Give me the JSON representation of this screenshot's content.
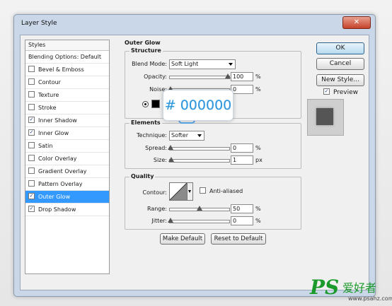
{
  "window": {
    "title": "Layer Style",
    "close_icon": "close-icon"
  },
  "styles_panel": {
    "header": "Styles",
    "blending": "Blending Options: Default",
    "items": [
      {
        "label": "Bevel & Emboss",
        "checked": false,
        "indent": false,
        "selected": false
      },
      {
        "label": "Contour",
        "checked": false,
        "indent": true,
        "selected": false
      },
      {
        "label": "Texture",
        "checked": false,
        "indent": true,
        "selected": false
      },
      {
        "label": "Stroke",
        "checked": false,
        "indent": false,
        "selected": false
      },
      {
        "label": "Inner Shadow",
        "checked": true,
        "indent": false,
        "selected": false
      },
      {
        "label": "Inner Glow",
        "checked": true,
        "indent": false,
        "selected": false
      },
      {
        "label": "Satin",
        "checked": false,
        "indent": false,
        "selected": false
      },
      {
        "label": "Color Overlay",
        "checked": false,
        "indent": false,
        "selected": false
      },
      {
        "label": "Gradient Overlay",
        "checked": false,
        "indent": false,
        "selected": false
      },
      {
        "label": "Pattern Overlay",
        "checked": false,
        "indent": false,
        "selected": false
      },
      {
        "label": "Outer Glow",
        "checked": true,
        "indent": false,
        "selected": true
      },
      {
        "label": "Drop Shadow",
        "checked": true,
        "indent": false,
        "selected": false
      }
    ]
  },
  "outer_glow": {
    "title": "Outer Glow",
    "structure": {
      "title": "Structure",
      "blend_mode_label": "Blend Mode:",
      "blend_mode": "Soft Light",
      "opacity_label": "Opacity:",
      "opacity": "100",
      "opacity_unit": "%",
      "noise_label": "Noise:",
      "noise": "0",
      "noise_unit": "%"
    },
    "color_hex": "# 000000",
    "elements": {
      "title": "Elements",
      "technique_label": "Technique:",
      "technique": "Softer",
      "spread_label": "Spread:",
      "spread": "0",
      "spread_unit": "%",
      "size_label": "Size:",
      "size": "1",
      "size_unit": "px"
    },
    "quality": {
      "title": "Quality",
      "contour_label": "Contour:",
      "anti_aliased_label": "Anti-aliased",
      "range_label": "Range:",
      "range": "50",
      "range_unit": "%",
      "jitter_label": "Jitter:",
      "jitter": "0",
      "jitter_unit": "%"
    },
    "make_default": "Make Default",
    "reset_default": "Reset to Default"
  },
  "actions": {
    "ok": "OK",
    "cancel": "Cancel",
    "new_style": "New Style...",
    "preview_label": "Preview",
    "preview_checked": true
  },
  "watermark": {
    "brand": "PS",
    "chinese": "爱好者",
    "url": "www.psahz.com"
  }
}
